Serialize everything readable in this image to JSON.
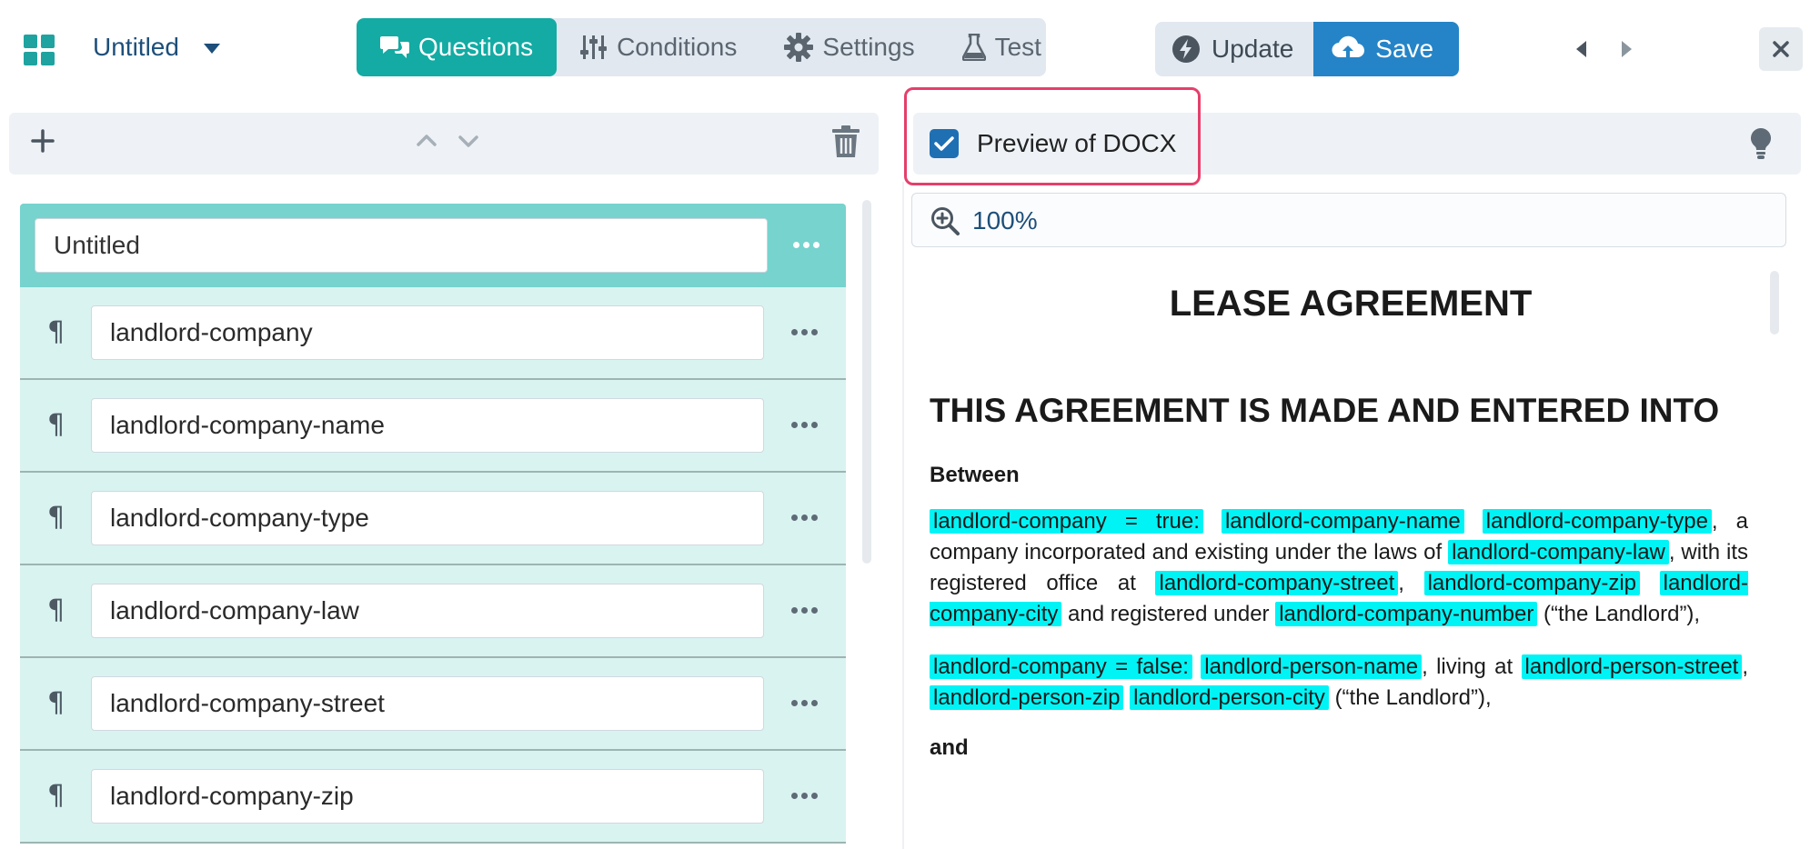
{
  "header": {
    "doc_title": "Untitled",
    "tabs": [
      {
        "label": "Questions",
        "active": true
      },
      {
        "label": "Conditions",
        "active": false
      },
      {
        "label": "Settings",
        "active": false
      },
      {
        "label": "Test",
        "active": false
      }
    ],
    "update_label": "Update",
    "save_label": "Save"
  },
  "questions": {
    "title_value": "Untitled",
    "rows": [
      "landlord-company",
      "landlord-company-name",
      "landlord-company-type",
      "landlord-company-law",
      "landlord-company-street",
      "landlord-company-zip"
    ]
  },
  "preview": {
    "checkbox_label": "Preview of DOCX",
    "checked": true,
    "zoom": "100%"
  },
  "document": {
    "title": "LEASE AGREEMENT",
    "heading": "THIS AGREEMENT IS MADE AND ENTERED INTO",
    "between": "Between",
    "and": "and",
    "p1": {
      "cond": "landlord-company = true:",
      "name": "landlord-company-name",
      "type": "landlord-company-type",
      "t1": ", a company incorporated and existing under the laws of",
      "law": "landlord-company-law",
      "t2": ", with its registered office at",
      "street": "landlord-company-street",
      "t3": ",",
      "zip": "landlord-company-zip",
      "city": "landlord-company-city",
      "t4": "and registered under",
      "number": "landlord-company-number",
      "t5": "(“the Landlord”),"
    },
    "p2": {
      "cond": "landlord-company = false:",
      "name": "landlord-person-name",
      "t1": ", living at",
      "street": "landlord-person-street",
      "t2": ",",
      "zip": "landlord-person-zip",
      "city": "landlord-person-city",
      "t3": "(“the Landlord”),"
    }
  },
  "colors": {
    "accent": "#13aba3",
    "save": "#2584c7",
    "highlight": "#00f4f6",
    "focus_outline": "#e53f6b"
  }
}
